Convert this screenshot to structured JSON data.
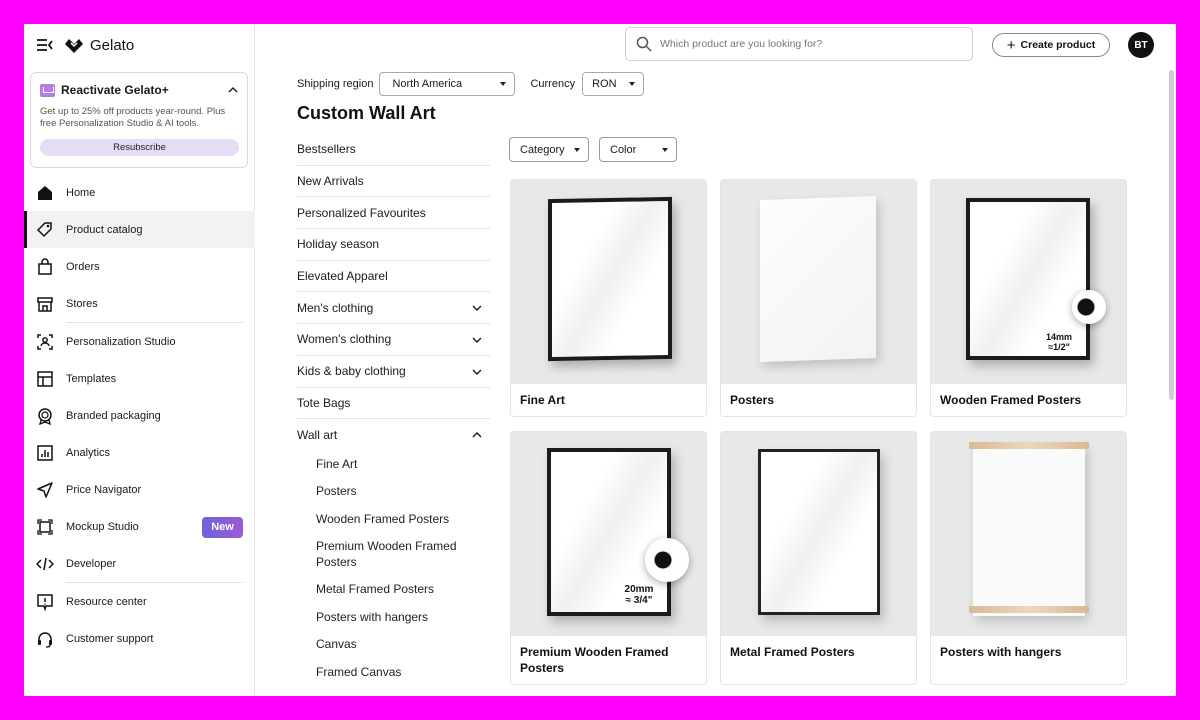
{
  "app": {
    "brand": "Gelato"
  },
  "promo": {
    "title": "Reactivate Gelato+",
    "text": "Get up to 25% off products year-round. Plus free Personalization Studio & AI tools.",
    "button": "Resubscribe"
  },
  "nav": {
    "items": [
      {
        "label": "Home",
        "icon": "home-icon"
      },
      {
        "label": "Product catalog",
        "icon": "tag-icon"
      },
      {
        "label": "Orders",
        "icon": "bag-icon"
      },
      {
        "label": "Stores",
        "icon": "store-icon"
      },
      {
        "label": "Personalization Studio",
        "icon": "personalization-icon"
      },
      {
        "label": "Templates",
        "icon": "templates-icon"
      },
      {
        "label": "Branded packaging",
        "icon": "badge-icon"
      },
      {
        "label": "Analytics",
        "icon": "analytics-icon"
      },
      {
        "label": "Price Navigator",
        "icon": "navigator-icon"
      },
      {
        "label": "Mockup Studio",
        "icon": "mockup-icon",
        "badge": "New"
      },
      {
        "label": "Developer",
        "icon": "code-icon"
      },
      {
        "label": "Resource center",
        "icon": "resource-icon"
      },
      {
        "label": "Customer support",
        "icon": "headset-icon"
      }
    ]
  },
  "topbar": {
    "search_placeholder": "Which product are you looking for?",
    "create_label": "Create product",
    "avatar_initials": "BT"
  },
  "filters_bar": {
    "shipping_label": "Shipping region",
    "shipping_value": "North America",
    "currency_label": "Currency",
    "currency_value": "RON"
  },
  "page_title": "Custom Wall Art",
  "categories": [
    "Bestsellers",
    "New Arrivals",
    "Personalized Favourites",
    "Holiday season",
    "Elevated Apparel",
    "Men's clothing",
    "Women's clothing",
    "Kids & baby clothing",
    "Tote Bags",
    "Wall art"
  ],
  "wall_art_sub": [
    "Fine Art",
    "Posters",
    "Wooden Framed Posters",
    "Premium Wooden Framed Posters",
    "Metal Framed Posters",
    "Posters with hangers",
    "Canvas",
    "Framed Canvas"
  ],
  "product_filters": {
    "category": "Category",
    "color": "Color"
  },
  "products": [
    {
      "title": "Fine Art"
    },
    {
      "title": "Posters"
    },
    {
      "title": "Wooden Framed Posters",
      "dim1": "14mm",
      "dim2": "≈1/2\""
    },
    {
      "title": "Premium Wooden Framed Posters",
      "dim1": "20mm",
      "dim2": "≈ 3/4\""
    },
    {
      "title": "Metal Framed Posters"
    },
    {
      "title": "Posters with hangers"
    }
  ]
}
